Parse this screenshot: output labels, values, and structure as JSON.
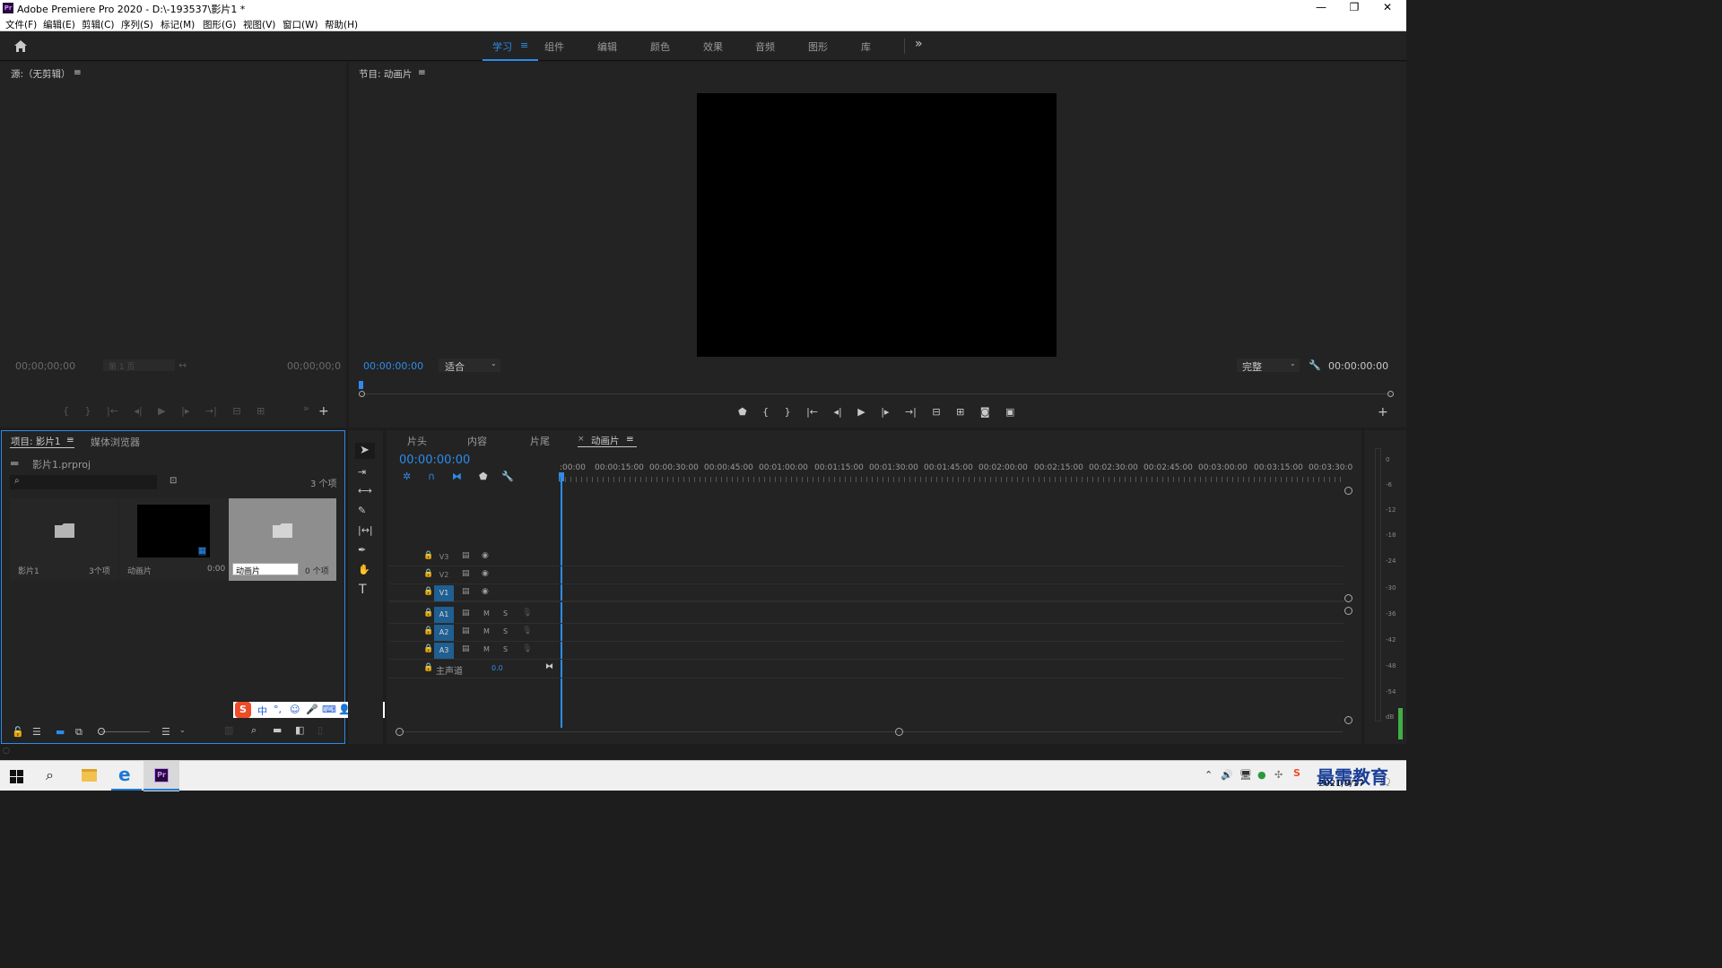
{
  "window": {
    "title": "Adobe Premiere Pro 2020 - D:\\-193537\\影片1 *",
    "app_icon": "Pr",
    "controls": [
      "—",
      "❐",
      "✕"
    ]
  },
  "menu": [
    "文件(F)",
    "编辑(E)",
    "剪辑(C)",
    "序列(S)",
    "标记(M)",
    "图形(G)",
    "视图(V)",
    "窗口(W)",
    "帮助(H)"
  ],
  "workspaces": {
    "items": [
      "学习",
      "组件",
      "编辑",
      "颜色",
      "效果",
      "音频",
      "图形",
      "库"
    ],
    "active": "学习",
    "overflow": "»"
  },
  "source_monitor": {
    "title": "源:（无剪辑）",
    "timecode_left": "00;00;00;00",
    "page_label": "第 1 页",
    "timecode_right": "00;00;00;0"
  },
  "program_monitor": {
    "title": "节目: 动画片",
    "timecode": "00:00:00:00",
    "fit": "适合",
    "quality": "完整",
    "duration": "00:00:00:00"
  },
  "project": {
    "tab_project": "项目: 影片1",
    "tab_media": "媒体浏览器",
    "file_name": "影片1.prproj",
    "item_count": "3 个项",
    "search_placeholder": "",
    "items": [
      {
        "name": "影片1",
        "meta": "3个项",
        "type": "bin"
      },
      {
        "name": "动画片",
        "meta": "0:00",
        "type": "sequence"
      },
      {
        "name": "动画片",
        "meta": "0 个项",
        "type": "bin-renaming"
      }
    ]
  },
  "ime_bar": {
    "items": [
      "中",
      "°,",
      "☺",
      "🎤",
      "⌨",
      "👤",
      "👕",
      "▦"
    ]
  },
  "timeline": {
    "tabs": [
      "片头",
      "内容",
      "片尾",
      "动画片"
    ],
    "active_tab": "动画片",
    "timecode": "00:00:00:00",
    "ruler": [
      ":00:00",
      "00:00:15:00",
      "00:00:30:00",
      "00:00:45:00",
      "00:01:00:00",
      "00:01:15:00",
      "00:01:30:00",
      "00:01:45:00",
      "00:02:00:00",
      "00:02:15:00",
      "00:02:30:00",
      "00:02:45:00",
      "00:03:00:00",
      "00:03:15:00",
      "00:03:30:0"
    ],
    "video_tracks": [
      "V3",
      "V2",
      "V1"
    ],
    "audio_tracks": [
      "A1",
      "A2",
      "A3"
    ],
    "mute_label": "M",
    "solo_label": "S",
    "master_label": "主声道",
    "master_value": "0.0"
  },
  "audio_meter": {
    "labels": [
      "0",
      "-6",
      "-12",
      "-18",
      "-24",
      "-30",
      "-36",
      "-42",
      "-48",
      "-54",
      "dB"
    ]
  },
  "taskbar": {
    "date": "2021/9/17",
    "watermark": "最需教育",
    "pr_label": "Pr"
  }
}
